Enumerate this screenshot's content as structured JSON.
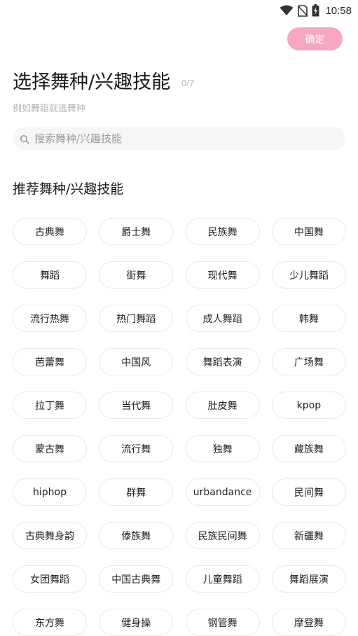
{
  "status_bar": {
    "time": "10:58",
    "icons": [
      "wifi-icon",
      "no-sim-icon",
      "battery-charging-icon"
    ]
  },
  "header": {
    "confirm_label": "确定",
    "title": "选择舞种/兴趣技能",
    "count": "0/7",
    "subtitle": "例如舞蹈就选舞种"
  },
  "search": {
    "placeholder": "搜索舞种/兴趣技能",
    "icon": "search-icon"
  },
  "recommended": {
    "title": "推荐舞种/兴趣技能",
    "tags": [
      "古典舞",
      "爵士舞",
      "民族舞",
      "中国舞",
      "舞蹈",
      "街舞",
      "现代舞",
      "少儿舞蹈",
      "流行热舞",
      "热门舞蹈",
      "成人舞蹈",
      "韩舞",
      "芭蕾舞",
      "中国风",
      "舞蹈表演",
      "广场舞",
      "拉丁舞",
      "当代舞",
      "肚皮舞",
      "kpop",
      "蒙古舞",
      "流行舞",
      "独舞",
      "藏族舞",
      "hiphop",
      "群舞",
      "urbandance",
      "民间舞",
      "古典舞身韵",
      "傣族舞",
      "民族民间舞",
      "新疆舞",
      "女团舞蹈",
      "中国古典舞",
      "儿童舞蹈",
      "舞蹈展演",
      "东方舞",
      "健身操",
      "钢管舞",
      "摩登舞"
    ]
  },
  "colors": {
    "accent": "#f7a6c3",
    "tag_border": "#e8e8e8",
    "search_bg": "#f5f6f8"
  }
}
